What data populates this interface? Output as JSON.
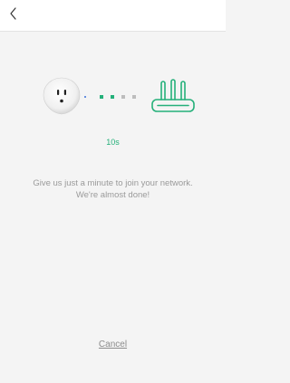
{
  "header": {
    "back_icon": "chevron-left-icon"
  },
  "illustration": {
    "device_icon": "smart-plug-icon",
    "router_icon": "router-icon",
    "progress_dots": [
      "on",
      "on",
      "off",
      "off"
    ]
  },
  "status": {
    "timer": "10s",
    "message_line1": "Give us just a minute to join your network.",
    "message_line2": "We're almost done!"
  },
  "actions": {
    "cancel_label": "Cancel"
  },
  "colors": {
    "accent": "#25b07a",
    "background": "#f4f4f4",
    "text_muted": "#9a9a9a"
  }
}
